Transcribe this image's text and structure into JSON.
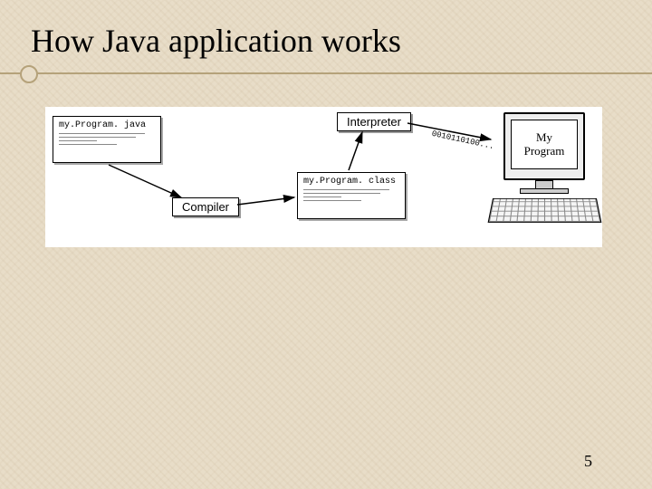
{
  "title": "How Java application works",
  "diagram": {
    "source_file": "my.Program. java",
    "compiler_label": "Compiler",
    "class_file": "my.Program. class",
    "interpreter_label": "Interpreter",
    "binary_stream": "0010110100...",
    "output_label": "My\nProgram"
  },
  "page_number": "5"
}
